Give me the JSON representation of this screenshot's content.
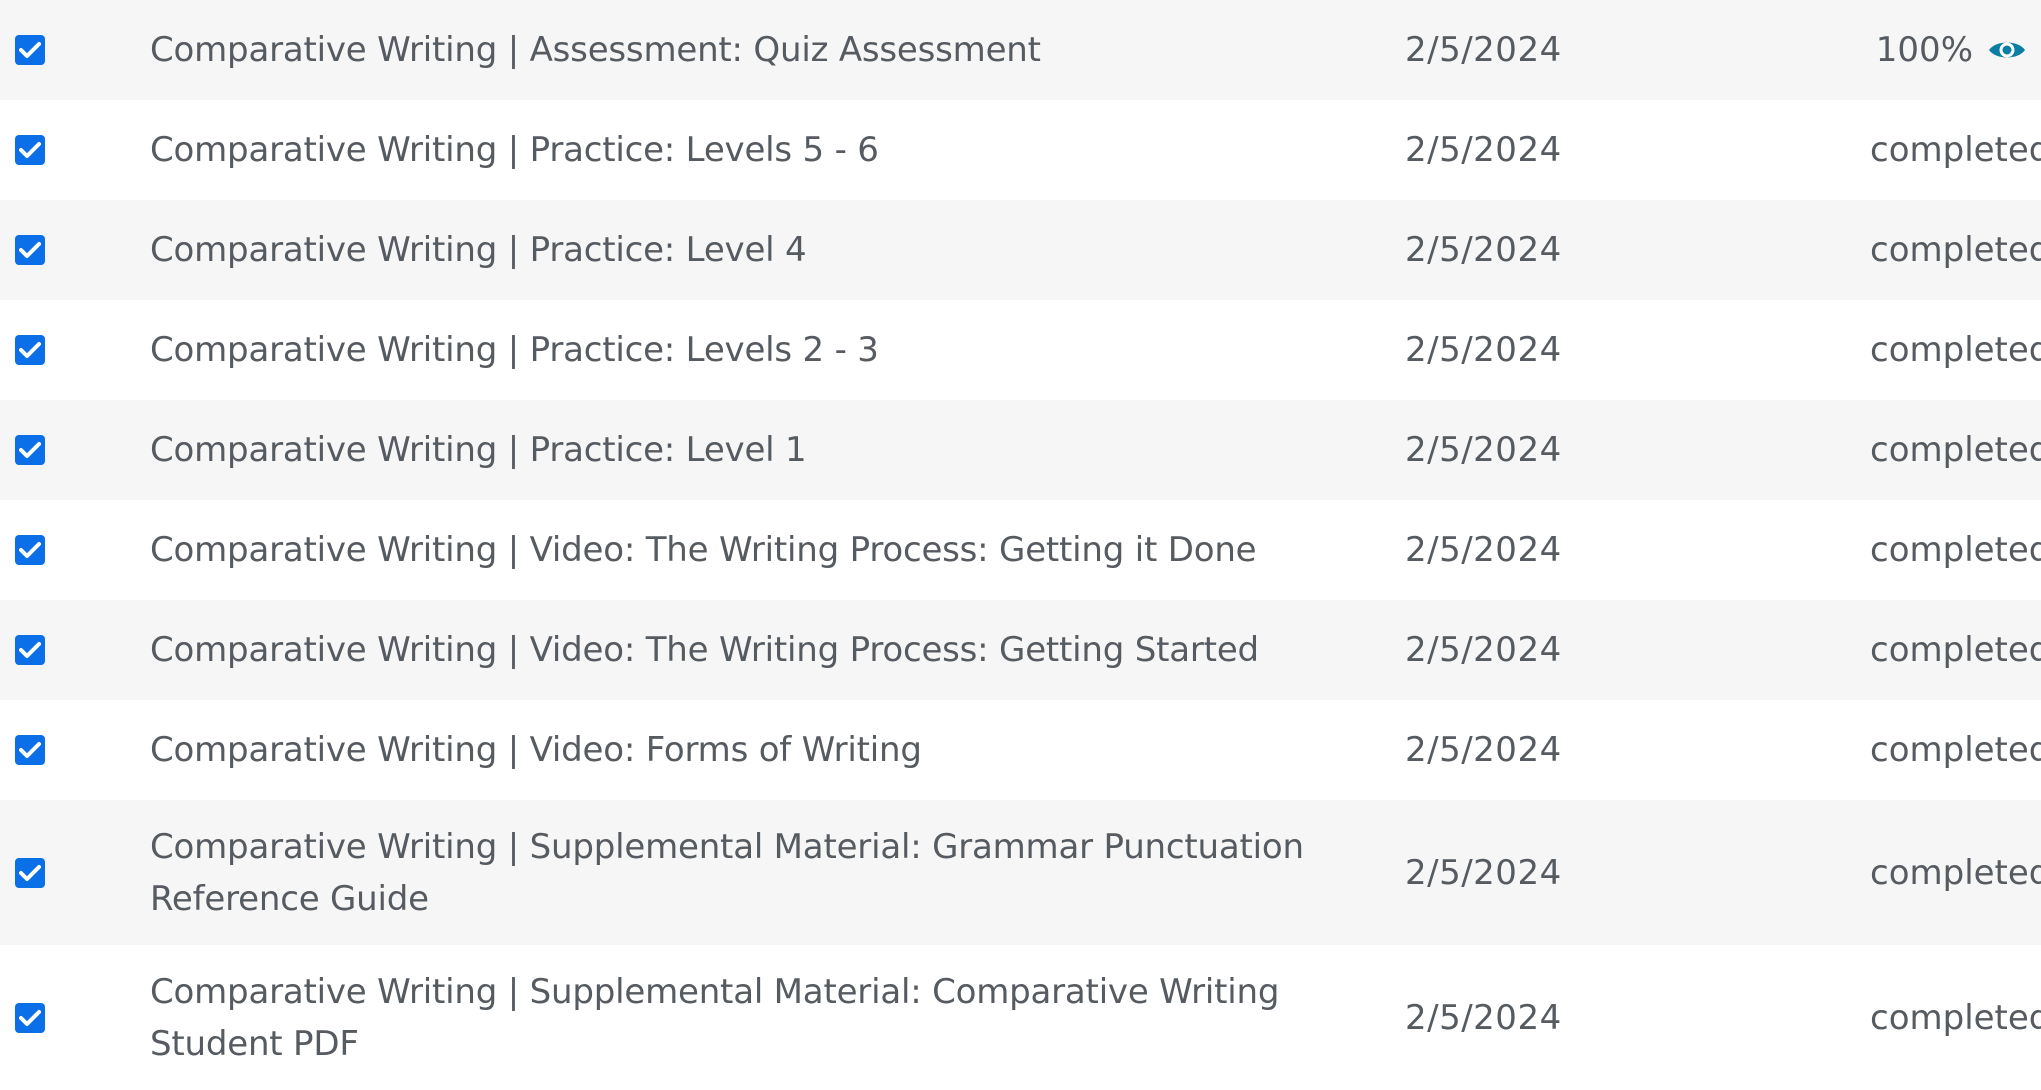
{
  "rows": [
    {
      "title": "Comparative Writing | Assessment: Quiz Assessment",
      "date": "2/5/2024",
      "status": "100%",
      "checked": true,
      "icon": "eye-icon"
    },
    {
      "title": "Comparative Writing | Practice: Levels 5 - 6",
      "date": "2/5/2024",
      "status": "completed",
      "checked": true
    },
    {
      "title": "Comparative Writing | Practice: Level 4",
      "date": "2/5/2024",
      "status": "completed",
      "checked": true
    },
    {
      "title": "Comparative Writing | Practice: Levels 2 - 3",
      "date": "2/5/2024",
      "status": "completed",
      "checked": true
    },
    {
      "title": "Comparative Writing | Practice: Level 1",
      "date": "2/5/2024",
      "status": "completed",
      "checked": true
    },
    {
      "title": "Comparative Writing | Video: The Writing Process: Getting it Done",
      "date": "2/5/2024",
      "status": "completed",
      "checked": true
    },
    {
      "title": "Comparative Writing | Video: The Writing Process: Getting Started",
      "date": "2/5/2024",
      "status": "completed",
      "checked": true
    },
    {
      "title": "Comparative Writing | Video: Forms of Writing",
      "date": "2/5/2024",
      "status": "completed",
      "checked": true
    },
    {
      "title": "Comparative Writing | Supplemental Material: Grammar Punctuation Reference Guide",
      "date": "2/5/2024",
      "status": "completed",
      "checked": true
    },
    {
      "title": "Comparative Writing | Supplemental Material: Comparative Writing Student PDF",
      "date": "2/5/2024",
      "status": "completed",
      "checked": true
    }
  ],
  "colors": {
    "checkbox": "#0b6fe8",
    "text": "#555b60",
    "eye_icon": "#0a7fa3",
    "row_alt": "#f6f6f6"
  }
}
